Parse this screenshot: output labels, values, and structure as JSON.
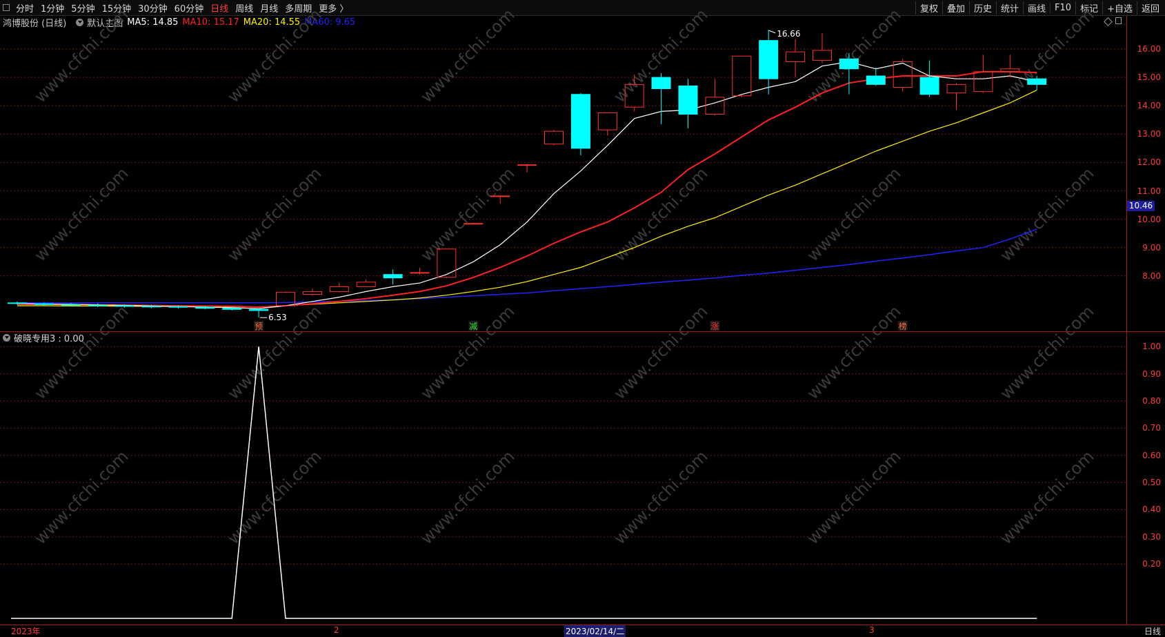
{
  "toolbar": {
    "periods": [
      "分时",
      "1分钟",
      "5分钟",
      "15分钟",
      "30分钟",
      "60分钟",
      "日线",
      "周线",
      "月线",
      "多周期",
      "更多 〉"
    ],
    "active_period": "日线",
    "actions": [
      "复权",
      "叠加",
      "历史",
      "统计",
      "画线",
      "F10",
      "标记",
      "+自选",
      "返回"
    ]
  },
  "main_chart": {
    "stock_label": "鸿博股份 (日线)",
    "template_label": "默认主图",
    "ma": [
      {
        "label": "MA5: 14.85",
        "color": "#ffffff"
      },
      {
        "label": "MA10: 15.17",
        "color": "#ff2020"
      },
      {
        "label": "MA20: 14.55",
        "color": "#ffee00"
      },
      {
        "label": "MA60: 9.65",
        "color": "#2222ff"
      }
    ],
    "high_annotation": "16.66",
    "low_annotation": "6.53",
    "y_ticks": [
      "16.00",
      "15.00",
      "14.00",
      "13.00",
      "12.00",
      "11.00",
      "10.00",
      "9.00",
      "8.00"
    ],
    "current_price": "10.46",
    "signals": [
      {
        "text": "预",
        "color": "#ff6a2a"
      },
      {
        "text": "减",
        "color": "#33dd33"
      },
      {
        "text": "涨",
        "color": "#ff3030"
      },
      {
        "text": "榜",
        "color": "#ff6a2a"
      }
    ]
  },
  "indicator": {
    "label": "破晓专用3 : 0.00",
    "y_ticks": [
      "1.00",
      "0.90",
      "0.80",
      "0.70",
      "0.60",
      "0.50",
      "0.40",
      "0.30",
      "0.20"
    ]
  },
  "x_axis": {
    "labels": [
      "2023年",
      "2",
      "3"
    ],
    "cursor_date": "2023/02/14/二",
    "period": "日线"
  },
  "chart_data": {
    "type": "candlestick",
    "y_range": [
      7.0,
      16.6
    ],
    "candles": [
      {
        "o": 7.05,
        "h": 7.1,
        "l": 6.98,
        "c": 7.03
      },
      {
        "o": 7.02,
        "h": 7.06,
        "l": 6.96,
        "c": 6.99
      },
      {
        "o": 6.99,
        "h": 7.04,
        "l": 6.94,
        "c": 6.97
      },
      {
        "o": 6.97,
        "h": 7.03,
        "l": 6.9,
        "c": 6.95
      },
      {
        "o": 6.95,
        "h": 6.99,
        "l": 6.88,
        "c": 6.93
      },
      {
        "o": 6.93,
        "h": 6.98,
        "l": 6.86,
        "c": 6.92
      },
      {
        "o": 6.92,
        "h": 6.96,
        "l": 6.85,
        "c": 6.9
      },
      {
        "o": 6.9,
        "h": 6.94,
        "l": 6.82,
        "c": 6.86
      },
      {
        "o": 6.86,
        "h": 6.9,
        "l": 6.78,
        "c": 6.82
      },
      {
        "o": 6.82,
        "h": 6.86,
        "l": 6.53,
        "c": 6.78
      },
      {
        "o": 6.95,
        "h": 7.45,
        "l": 6.92,
        "c": 7.42
      },
      {
        "o": 7.35,
        "h": 7.55,
        "l": 7.3,
        "c": 7.45
      },
      {
        "o": 7.45,
        "h": 7.75,
        "l": 7.42,
        "c": 7.62
      },
      {
        "o": 7.62,
        "h": 7.88,
        "l": 7.6,
        "c": 7.78
      },
      {
        "o": 8.05,
        "h": 8.22,
        "l": 7.7,
        "c": 7.93
      },
      {
        "o": 8.1,
        "h": 8.28,
        "l": 8.05,
        "c": 8.12
      },
      {
        "o": 7.95,
        "h": 8.95,
        "l": 7.92,
        "c": 8.95
      },
      {
        "o": 9.85,
        "h": 9.88,
        "l": 9.83,
        "c": 9.85
      },
      {
        "o": 10.8,
        "h": 10.85,
        "l": 10.55,
        "c": 10.82
      },
      {
        "o": 11.9,
        "h": 11.95,
        "l": 11.65,
        "c": 11.92
      },
      {
        "o": 12.65,
        "h": 13.15,
        "l": 12.6,
        "c": 13.1
      },
      {
        "o": 14.4,
        "h": 14.45,
        "l": 12.25,
        "c": 12.5
      },
      {
        "o": 13.15,
        "h": 13.75,
        "l": 12.95,
        "c": 13.75
      },
      {
        "o": 13.95,
        "h": 15.1,
        "l": 13.8,
        "c": 14.75
      },
      {
        "o": 15.0,
        "h": 15.15,
        "l": 13.35,
        "c": 14.6
      },
      {
        "o": 14.7,
        "h": 14.95,
        "l": 13.2,
        "c": 13.7
      },
      {
        "o": 13.7,
        "h": 14.95,
        "l": 13.65,
        "c": 14.3
      },
      {
        "o": 14.35,
        "h": 15.75,
        "l": 14.3,
        "c": 15.75
      },
      {
        "o": 16.3,
        "h": 16.66,
        "l": 14.4,
        "c": 14.95
      },
      {
        "o": 15.55,
        "h": 16.35,
        "l": 15.0,
        "c": 15.9
      },
      {
        "o": 15.6,
        "h": 16.55,
        "l": 15.5,
        "c": 15.95
      },
      {
        "o": 15.65,
        "h": 15.85,
        "l": 14.4,
        "c": 15.3
      },
      {
        "o": 15.05,
        "h": 15.35,
        "l": 14.7,
        "c": 14.75
      },
      {
        "o": 14.65,
        "h": 15.65,
        "l": 14.5,
        "c": 15.55
      },
      {
        "o": 15.0,
        "h": 15.6,
        "l": 14.3,
        "c": 14.4
      },
      {
        "o": 14.45,
        "h": 14.8,
        "l": 13.85,
        "c": 14.75
      },
      {
        "o": 14.5,
        "h": 15.8,
        "l": 14.45,
        "c": 15.2
      },
      {
        "o": 15.2,
        "h": 15.8,
        "l": 15.0,
        "c": 15.3
      },
      {
        "o": 14.95,
        "h": 15.05,
        "l": 14.55,
        "c": 14.75
      }
    ],
    "ma5": [
      7.03,
      7.01,
      7.0,
      6.98,
      6.96,
      6.94,
      6.92,
      6.9,
      6.88,
      6.85,
      6.95,
      7.1,
      7.25,
      7.45,
      7.62,
      7.75,
      8.05,
      8.5,
      9.1,
      9.9,
      10.9,
      11.7,
      12.6,
      13.55,
      13.8,
      13.85,
      14.1,
      14.4,
      14.65,
      14.85,
      15.4,
      15.55,
      15.3,
      15.5,
      15.05,
      14.95,
      14.95,
      15.05,
      14.85
    ],
    "ma10": [
      7.0,
      7.0,
      6.99,
      6.98,
      6.97,
      6.96,
      6.95,
      6.94,
      6.93,
      6.9,
      6.95,
      7.02,
      7.1,
      7.2,
      7.32,
      7.45,
      7.65,
      7.95,
      8.3,
      8.7,
      9.15,
      9.55,
      9.9,
      10.4,
      10.95,
      11.75,
      12.3,
      12.9,
      13.5,
      13.95,
      14.45,
      14.8,
      14.95,
      15.05,
      15.05,
      15.05,
      15.2,
      15.2,
      15.17
    ],
    "ma20": [
      6.95,
      6.95,
      6.94,
      6.94,
      6.93,
      6.93,
      6.92,
      6.92,
      6.91,
      6.91,
      6.95,
      7.0,
      7.05,
      7.1,
      7.15,
      7.22,
      7.32,
      7.45,
      7.6,
      7.8,
      8.05,
      8.3,
      8.65,
      9.0,
      9.4,
      9.75,
      10.05,
      10.45,
      10.85,
      11.2,
      11.6,
      12.0,
      12.4,
      12.75,
      13.1,
      13.4,
      13.75,
      14.1,
      14.55
    ],
    "ma60": [
      7.05,
      7.05,
      7.05,
      7.05,
      7.05,
      7.05,
      7.05,
      7.05,
      7.05,
      7.05,
      7.06,
      7.08,
      7.1,
      7.13,
      7.16,
      7.2,
      7.25,
      7.3,
      7.35,
      7.4,
      7.48,
      7.55,
      7.62,
      7.7,
      7.78,
      7.85,
      7.93,
      8.02,
      8.1,
      8.2,
      8.3,
      8.4,
      8.52,
      8.63,
      8.75,
      8.88,
      9.0,
      9.3,
      9.65
    ],
    "indicator_series": {
      "name": "破晓专用3",
      "y_range": [
        0.0,
        1.0
      ],
      "values": [
        0,
        0,
        0,
        0,
        0,
        0,
        0,
        0,
        0,
        1,
        0,
        0,
        0,
        0,
        0,
        0,
        0,
        0,
        0,
        0,
        0,
        0,
        0,
        0,
        0,
        0,
        0,
        0,
        0,
        0,
        0,
        0,
        0,
        0,
        0,
        0,
        0,
        0,
        0
      ]
    }
  },
  "watermark": "www.cfchi.com",
  "colors": {
    "up": "#ff3030",
    "down": "#00ffff",
    "axis": "#ff3b3b",
    "grid": "#7a1515"
  }
}
